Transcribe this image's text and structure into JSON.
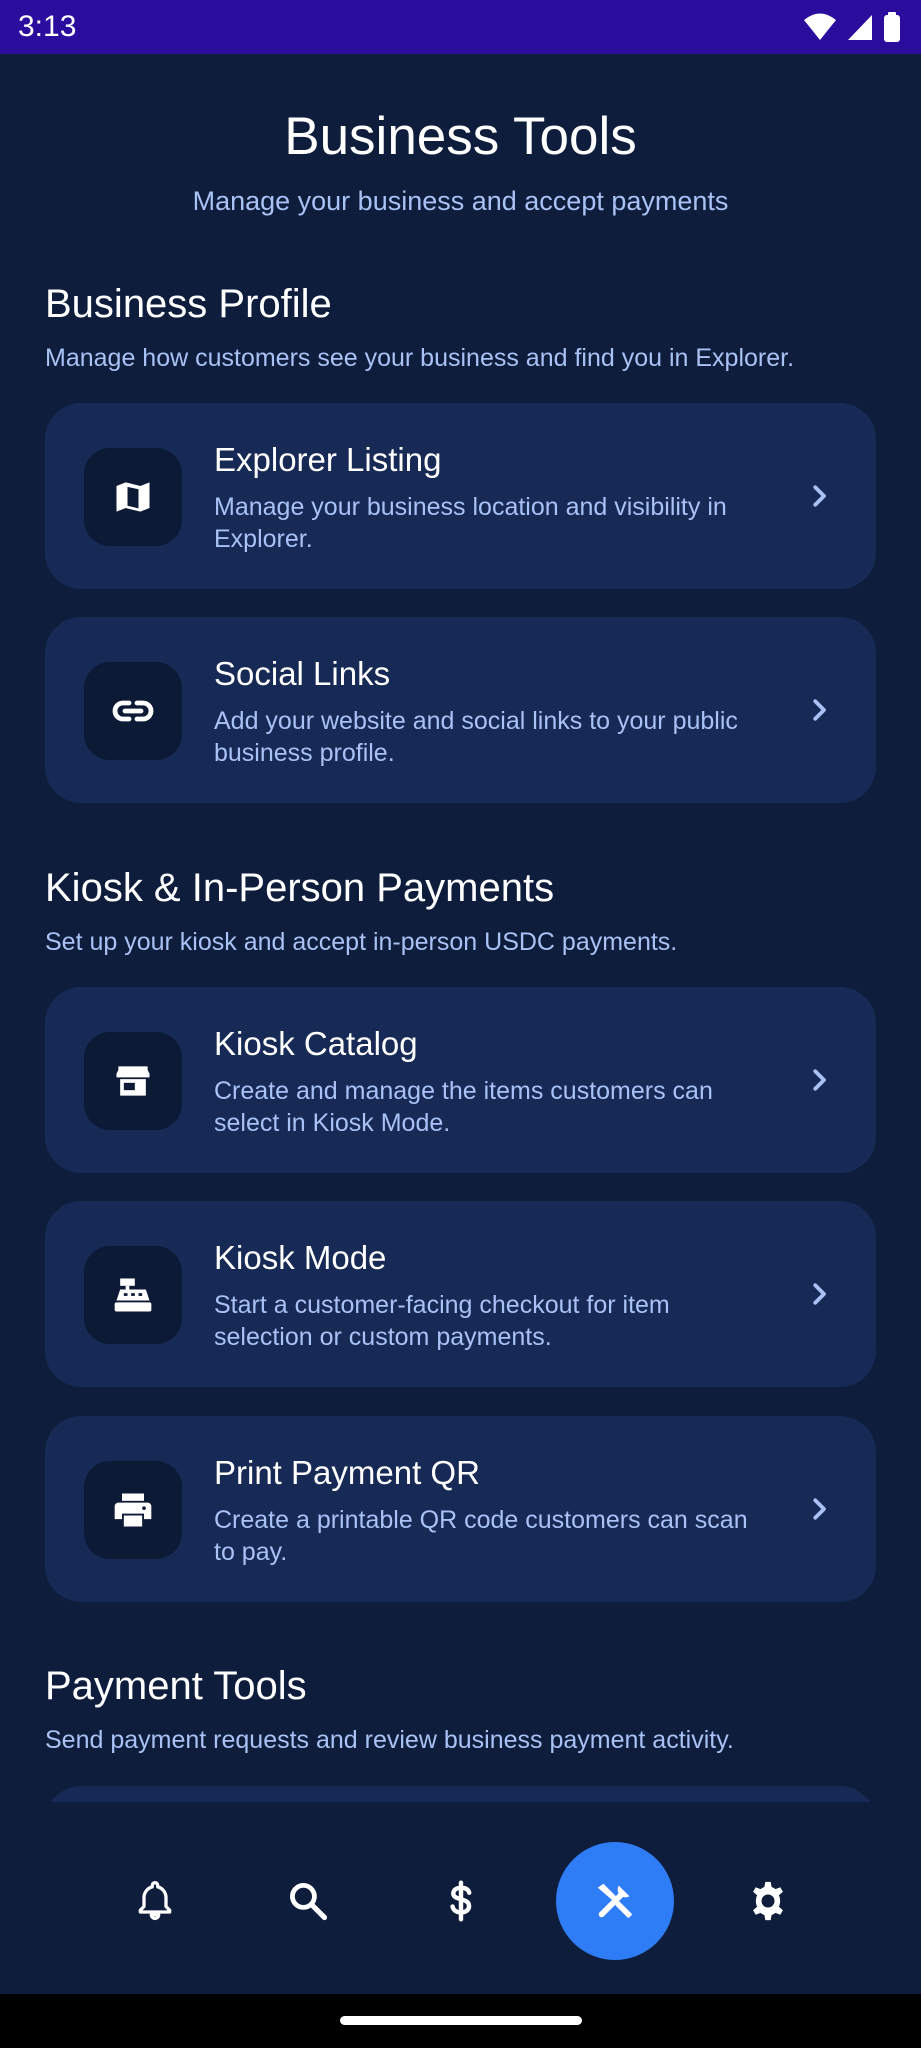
{
  "status_bar": {
    "time": "3:13",
    "icons": [
      "wifi-icon",
      "signal-icon",
      "battery-icon"
    ]
  },
  "header": {
    "title": "Business Tools",
    "subtitle": "Manage your business and accept payments"
  },
  "sections": [
    {
      "title": "Business Profile",
      "description": "Manage how customers see your business and find you in Explorer.",
      "cards": [
        {
          "icon": "map-icon",
          "title": "Explorer Listing",
          "description": "Manage your business location and visibility in Explorer."
        },
        {
          "icon": "link-icon",
          "title": "Social Links",
          "description": "Add your website and social links to your public business profile."
        }
      ]
    },
    {
      "title": "Kiosk & In-Person Payments",
      "description": "Set up your kiosk and accept in-person USDC payments.",
      "cards": [
        {
          "icon": "storefront-icon",
          "title": "Kiosk Catalog",
          "description": "Create and manage the items customers can select in Kiosk Mode."
        },
        {
          "icon": "cash-register-icon",
          "title": "Kiosk Mode",
          "description": "Start a customer-facing checkout for item selection or custom payments."
        },
        {
          "icon": "printer-icon",
          "title": "Print Payment QR",
          "description": "Create a printable QR code customers can scan to pay."
        }
      ]
    },
    {
      "title": "Payment Tools",
      "description": "Send payment requests and review business payment activity."
    }
  ],
  "bottom_nav": {
    "items": [
      "bell-icon",
      "search-icon",
      "dollar-icon",
      "tools-icon",
      "gear-icon"
    ],
    "active": "tools-icon"
  },
  "colors": {
    "background": "#0d1d3b",
    "card": "#172a55",
    "icon_tile": "#0c1a36",
    "accent": "#2f7df6",
    "muted_text": "#a9c1f5",
    "status_bar": "#2b0d9e"
  }
}
